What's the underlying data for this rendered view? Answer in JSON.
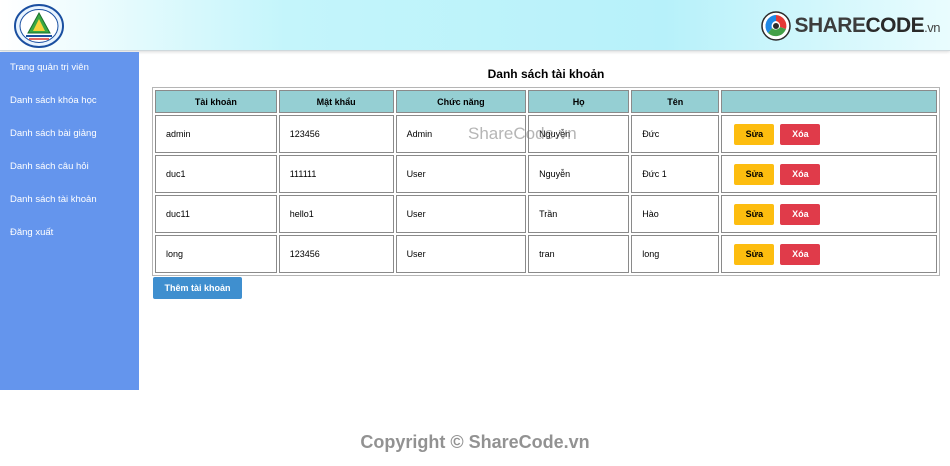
{
  "brand": {
    "part1": "SHARE",
    "part2": "CODE",
    "part3": ".vn"
  },
  "sidebar": {
    "items": [
      {
        "label": "Trang quản trị viên"
      },
      {
        "label": "Danh sách khóa học"
      },
      {
        "label": "Danh sách bài giảng"
      },
      {
        "label": "Danh sách câu hỏi"
      },
      {
        "label": "Danh sách tài khoản"
      },
      {
        "label": "Đăng xuất"
      }
    ]
  },
  "main": {
    "title": "Danh sách tài khoản",
    "columns": [
      "Tài khoản",
      "Mật khẩu",
      "Chức năng",
      "Họ",
      "Tên",
      ""
    ],
    "rows": [
      {
        "username": "admin",
        "password": "123456",
        "role": "Admin",
        "lastname": "Nguyễn",
        "firstname": "Đức"
      },
      {
        "username": "duc1",
        "password": "111111",
        "role": "User",
        "lastname": "Nguyễn",
        "firstname": "Đức 1"
      },
      {
        "username": "duc11",
        "password": "hello1",
        "role": "User",
        "lastname": "Trần",
        "firstname": "Hào"
      },
      {
        "username": "long",
        "password": "123456",
        "role": "User",
        "lastname": "tran",
        "firstname": "long"
      }
    ],
    "edit_label": "Sửa",
    "delete_label": "Xóa",
    "add_label": "Thêm tài khoản"
  },
  "watermarks": {
    "middle": "ShareCode.vn",
    "footer": "Copyright © ShareCode.vn"
  },
  "colors": {
    "sidebar": "#6495ed",
    "table_header": "#95cfd3",
    "edit_button": "#fdbd0f",
    "delete_button": "#e03b4a",
    "add_button": "#3f8fcf"
  }
}
